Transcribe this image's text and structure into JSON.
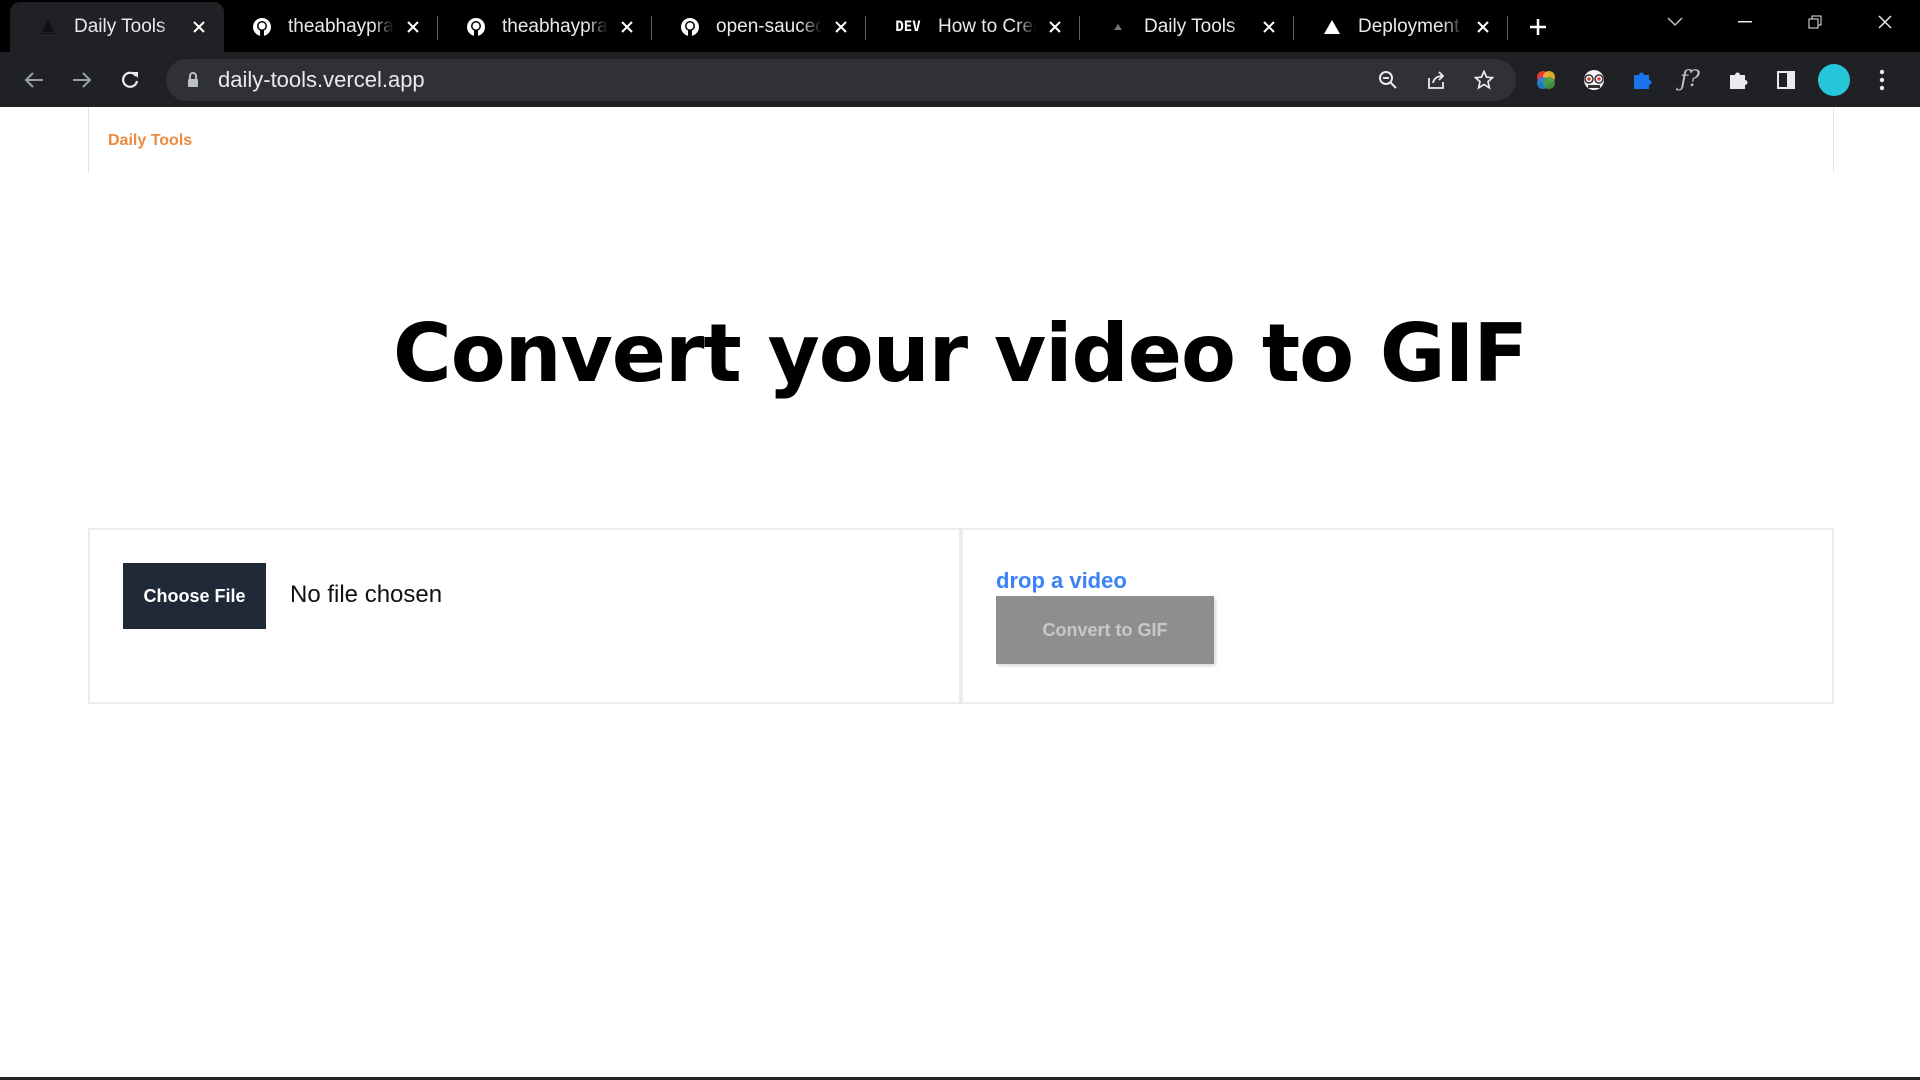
{
  "browser": {
    "tabs": [
      {
        "title": "Daily Tools",
        "icon": "vercel-triangle-icon",
        "active": true
      },
      {
        "title": "theabhayprajapati",
        "icon": "github-icon",
        "active": false
      },
      {
        "title": "theabhayprajapati",
        "icon": "github-icon",
        "active": false
      },
      {
        "title": "open-sauced/hot",
        "icon": "github-icon",
        "active": false
      },
      {
        "title": "How to Create",
        "icon": "dev-icon",
        "active": false
      },
      {
        "title": "Daily Tools",
        "icon": "vercel-triangle-icon",
        "active": false
      },
      {
        "title": "Deployment Overview",
        "icon": "vercel-triangle-icon",
        "active": false
      }
    ],
    "dev_favicon_text": "DEV",
    "url": "daily-tools.vercel.app"
  },
  "page": {
    "brand": "Daily Tools",
    "heading": "Convert your video to GIF",
    "choose_file_label": "Choose File",
    "no_file_text": "No file chosen",
    "drop_label": "drop a video",
    "convert_label": "Convert to GIF"
  },
  "colors": {
    "brand": "#ea8a3e",
    "drop_label": "#3b82f6",
    "choose_button": "#1f2937",
    "convert_button_disabled": "#8e8e8e"
  }
}
